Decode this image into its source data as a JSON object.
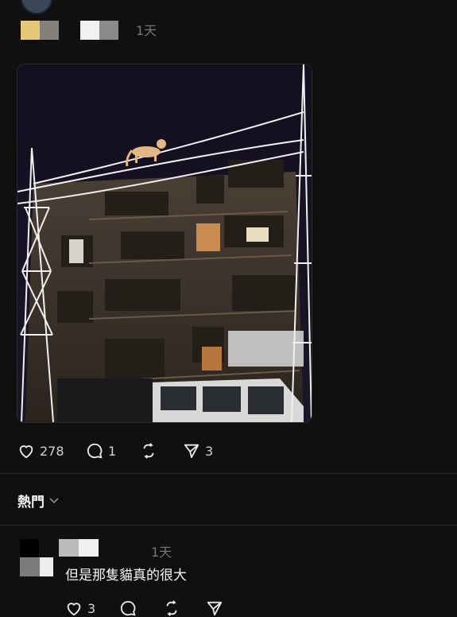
{
  "post": {
    "time": "1天",
    "actions": {
      "likes": "278",
      "comments": "1",
      "shares": "3"
    }
  },
  "section": {
    "title": "熱門"
  },
  "reply": {
    "time": "1天",
    "text": "但是那隻貓真的很大",
    "likes": "3"
  },
  "colors": {
    "background": "#101010",
    "text": "#f3f5f7",
    "muted": "#777777",
    "divider": "#2d2d2d"
  }
}
